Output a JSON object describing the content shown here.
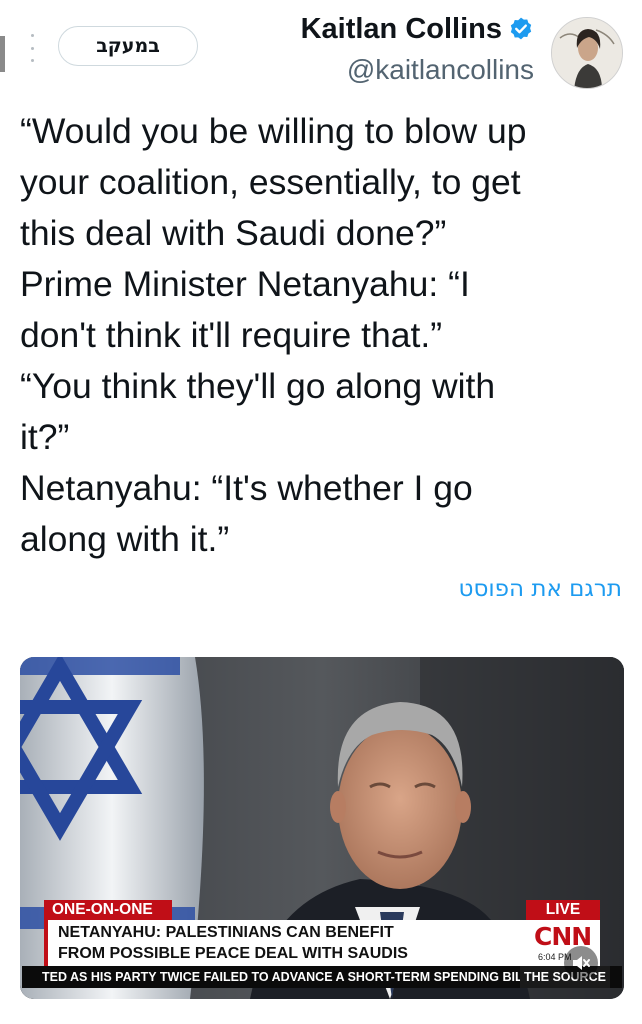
{
  "header": {
    "follow_label": "במעקב",
    "display_name": "Kaitlan Collins",
    "handle": "@kaitlancollins",
    "verified_icon": "verified-badge-icon",
    "more_icon": "more-vertical-icon"
  },
  "tweet": {
    "lines": [
      "“Would you be willing to blow up",
      "your coalition, essentially, to get",
      "this deal with Saudi done?”",
      "Prime Minister Netanyahu:  “I",
      "don't think it'll require that.”",
      "“You think they'll go along with",
      "it?”",
      "Netanyahu: “It's whether I go",
      "along with it.”"
    ],
    "translate_label": "תרגם את הפוסט"
  },
  "video": {
    "tag_left": "ONE-ON-ONE",
    "tag_right": "LIVE",
    "headline_line1": "NETANYAHU: PALESTINIANS CAN BENEFIT",
    "headline_line2": "FROM POSSIBLE PEACE DEAL WITH SAUDIS",
    "network": "CNN",
    "time": "6:04 PM",
    "ticker": "TED AS HIS PARTY TWICE FAILED TO ADVANCE A SHORT-TERM SPENDING BILL",
    "ticker_source": "THE SOURCE",
    "mute_icon": "speaker-muted-icon"
  },
  "colors": {
    "link_blue": "#1d9bf0",
    "cnn_red": "#c00e17",
    "text": "#0f1419",
    "secondary": "#536471"
  }
}
